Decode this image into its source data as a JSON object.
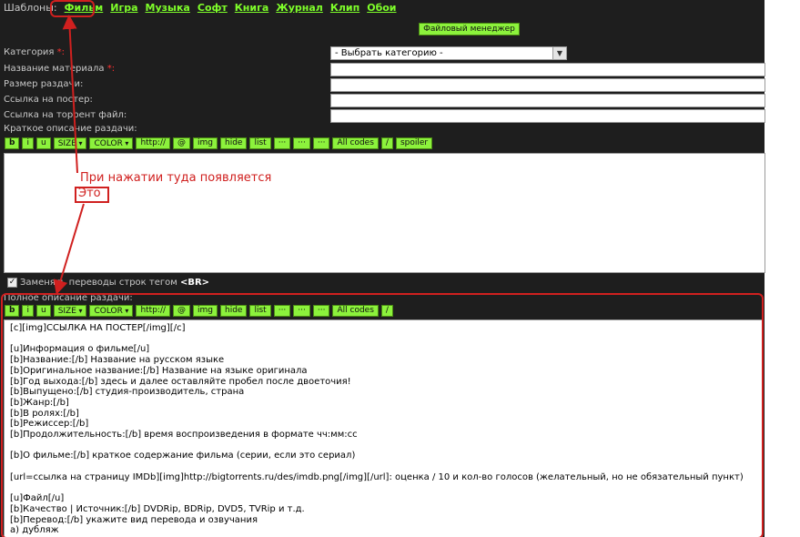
{
  "templates": {
    "label": "Шаблоны:",
    "links": [
      "Фильм",
      "Игра",
      "Музыка",
      "Софт",
      "Книга",
      "Журнал",
      "Клип",
      "Обои"
    ]
  },
  "file_manager_label": "Файловый менеджер",
  "form": {
    "category_label": "Категория",
    "category_value": "- Выбрать категорию -",
    "required_mark": "*:",
    "name_label": "Название материала",
    "size_label": "Размер раздачи:",
    "poster_label": "Ссылка на постер:",
    "torrent_label": "Ссылка на торрент файл:",
    "short_desc_label": "Краткое описание раздачи:",
    "full_desc_label": "Полное описание раздачи:"
  },
  "toolbar_short": [
    "b",
    "i",
    "u",
    "SIZE",
    "COLOR",
    "http://",
    "@",
    "img",
    "hide",
    "list",
    "···",
    "···",
    "···",
    "All codes",
    "/",
    "spoiler"
  ],
  "toolbar_full": [
    "b",
    "i",
    "u",
    "SIZE",
    "COLOR",
    "http://",
    "@",
    "img",
    "hide",
    "list",
    "···",
    "···",
    "···",
    "All codes",
    "/"
  ],
  "checkbox": {
    "checked_glyph": "✓",
    "label": "Заменять переводы строк тегом ",
    "tag": "<BR>"
  },
  "full_desc_lines": [
    "[c][img]ССЫЛКА НА ПОСТЕР[/img][/c]",
    "",
    "[u]Информация о фильме[/u]",
    "[b]Название:[/b] Название на русском языке",
    "[b]Оригинальное название:[/b] Название на языке оригинала",
    "[b]Год выхода:[/b] здесь и далее оставляйте пробел после двоеточия!",
    "[b]Выпущено:[/b] студия-производитель, страна",
    "[b]Жанр:[/b]",
    "[b]В ролях:[/b]",
    "[b]Режиссер:[/b]",
    "[b]Продолжительность:[/b] время воспроизведения в формате чч:мм:сс",
    "",
    "[b]О фильме:[/b] краткое содержание фильма (серии, если это сериал)",
    "",
    "[url=ссылка на страницу IMDb][img]http://bigtorrents.ru/des/imdb.png[/img][/url]: оценка / 10 и кол-во голосов (желательный, но не обязательный пункт)",
    "",
    "[u]Файл[/u]",
    "[b]Качество | Источник:[/b] DVDRip, BDRip, DVD5, TVRip и т.д.",
    "[b]Перевод:[/b] укажите вид перевода и озвучания",
    "а) дубляж"
  ],
  "annotation": {
    "line1": "При нажатии туда появляется",
    "line2": "Это"
  },
  "colors": {
    "accent_green": "#8cf23c",
    "link_green": "#7fff2a",
    "annotation_red": "#d0201f",
    "panel_dark": "#1e1e1e"
  }
}
